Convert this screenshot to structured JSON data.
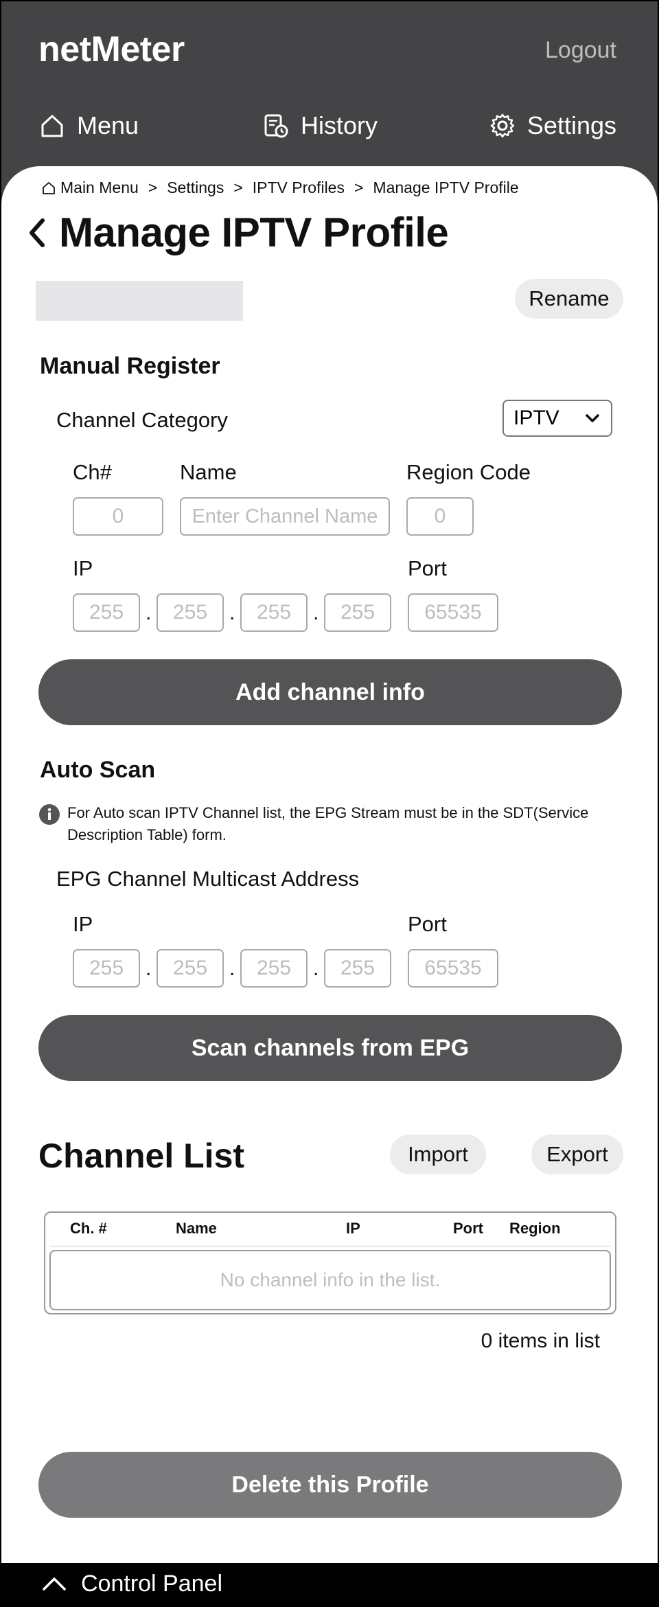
{
  "header": {
    "brand": "netMeter",
    "logout": "Logout",
    "nav": [
      {
        "label": "Menu",
        "icon": "home-icon"
      },
      {
        "label": "History",
        "icon": "history-icon"
      },
      {
        "label": "Settings",
        "icon": "gear-icon"
      }
    ]
  },
  "breadcrumb": [
    "Main Menu",
    "Settings",
    "IPTV Profiles",
    "Manage IPTV Profile"
  ],
  "page": {
    "title": "Manage IPTV Profile",
    "profile_name_value": "",
    "rename_label": "Rename"
  },
  "manual_register": {
    "heading": "Manual Register",
    "category_label": "Channel Category",
    "category_selected": "IPTV",
    "ch_label": "Ch#",
    "ch_placeholder": "0",
    "name_label": "Name",
    "name_placeholder": "Enter Channel Name",
    "region_label": "Region Code",
    "region_placeholder": "0",
    "ip_label": "IP",
    "ip_placeholders": [
      "255",
      "255",
      "255",
      "255"
    ],
    "port_label": "Port",
    "port_placeholder": "65535",
    "add_button": "Add channel info"
  },
  "auto_scan": {
    "heading": "Auto Scan",
    "info_line1": "For Auto scan IPTV Channel list, the EPG Stream must be in the SDT(Service",
    "info_line2": "Description Table) form.",
    "epg_label": "EPG Channel Multicast Address",
    "ip_label": "IP",
    "ip_placeholders": [
      "255",
      "255",
      "255",
      "255"
    ],
    "port_label": "Port",
    "port_placeholder": "65535",
    "scan_button": "Scan channels from EPG"
  },
  "channel_list": {
    "heading": "Channel List",
    "import_label": "Import",
    "export_label": "Export",
    "columns": [
      "Ch. #",
      "Name",
      "IP",
      "Port",
      "Region"
    ],
    "empty_text": "No channel info in the list.",
    "count_text": "0 items in list"
  },
  "delete_button": "Delete this Profile",
  "control_panel": "Control Panel",
  "colors": {
    "header_bg": "#444446",
    "primary_button": "#545456",
    "delete_button": "#7a7a7c",
    "placeholder": "#bdbdbd"
  }
}
